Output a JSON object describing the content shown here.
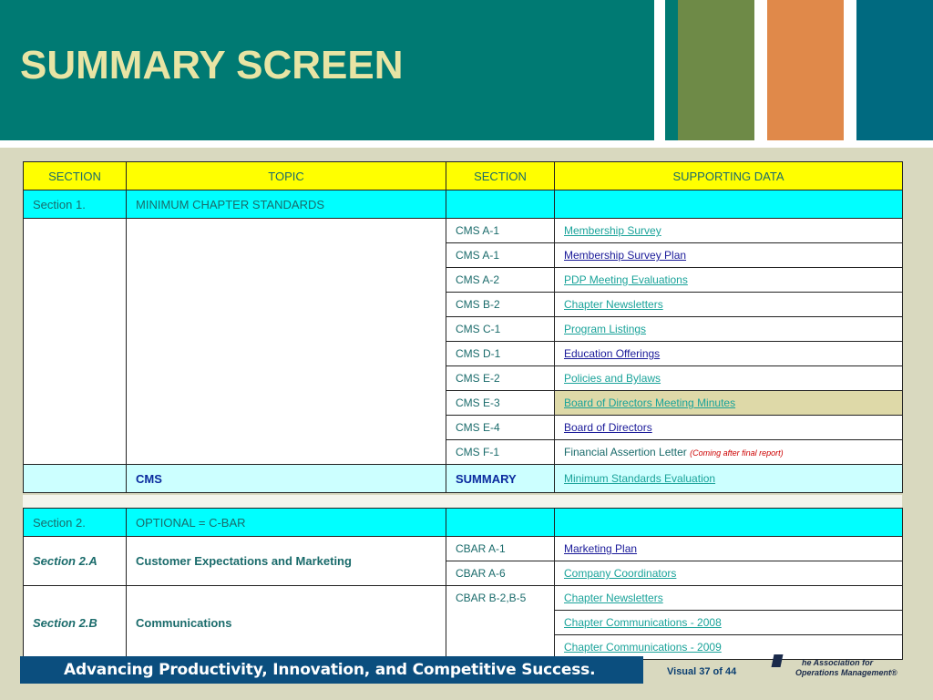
{
  "title": "SUMMARY SCREEN",
  "table": {
    "headers": [
      "SECTION",
      "TOPIC",
      "SECTION",
      "SUPPORTING DATA"
    ],
    "section1": {
      "section": "Section 1.",
      "topic": "MINIMUM CHAPTER STANDARDS",
      "rows": [
        {
          "code": "CMS A-1",
          "data": "Membership Survey"
        },
        {
          "code": "CMS A-1",
          "data": "Membership Survey Plan"
        },
        {
          "code": "CMS A-2",
          "data": "PDP Meeting Evaluations"
        },
        {
          "code": "CMS B-2",
          "data": "Chapter Newsletters"
        },
        {
          "code": "CMS C-1",
          "data": "Program Listings"
        },
        {
          "code": "CMS D-1",
          "data": "Education Offerings"
        },
        {
          "code": "CMS E-2",
          "data": "Policies and Bylaws"
        },
        {
          "code": "CMS E-3",
          "data": "Board of Directors Meeting Minutes"
        },
        {
          "code": "CMS E-4",
          "data": "Board of Directors"
        },
        {
          "code": "CMS F-1",
          "data": "Financial Assertion Letter",
          "note": "(Coming after final report)"
        }
      ],
      "summary": {
        "topic": "CMS",
        "section": "SUMMARY",
        "data": "Minimum Standards Evaluation"
      }
    },
    "section2": {
      "section": "Section 2.",
      "topic": "OPTIONAL = C-BAR",
      "a": {
        "section": "Section 2.A",
        "topic": "Customer Expectations and Marketing",
        "rows": [
          {
            "code": "CBAR A-1",
            "data": "Marketing Plan"
          },
          {
            "code": "CBAR A-6",
            "data": "Company Coordinators"
          }
        ]
      },
      "b": {
        "section": "Section 2.B",
        "topic": "Communications",
        "code": "CBAR B-2,B-5",
        "rows": [
          "Chapter Newsletters",
          "Chapter Communications - 2008",
          "Chapter Communications - 2009"
        ]
      }
    }
  },
  "footer": {
    "tagline": "Advancing Productivity, Innovation, and Competitive Success.",
    "visual": "Visual 37 of 44",
    "logo_line1": "he Association for",
    "logo_line2": "Operations Management®"
  }
}
